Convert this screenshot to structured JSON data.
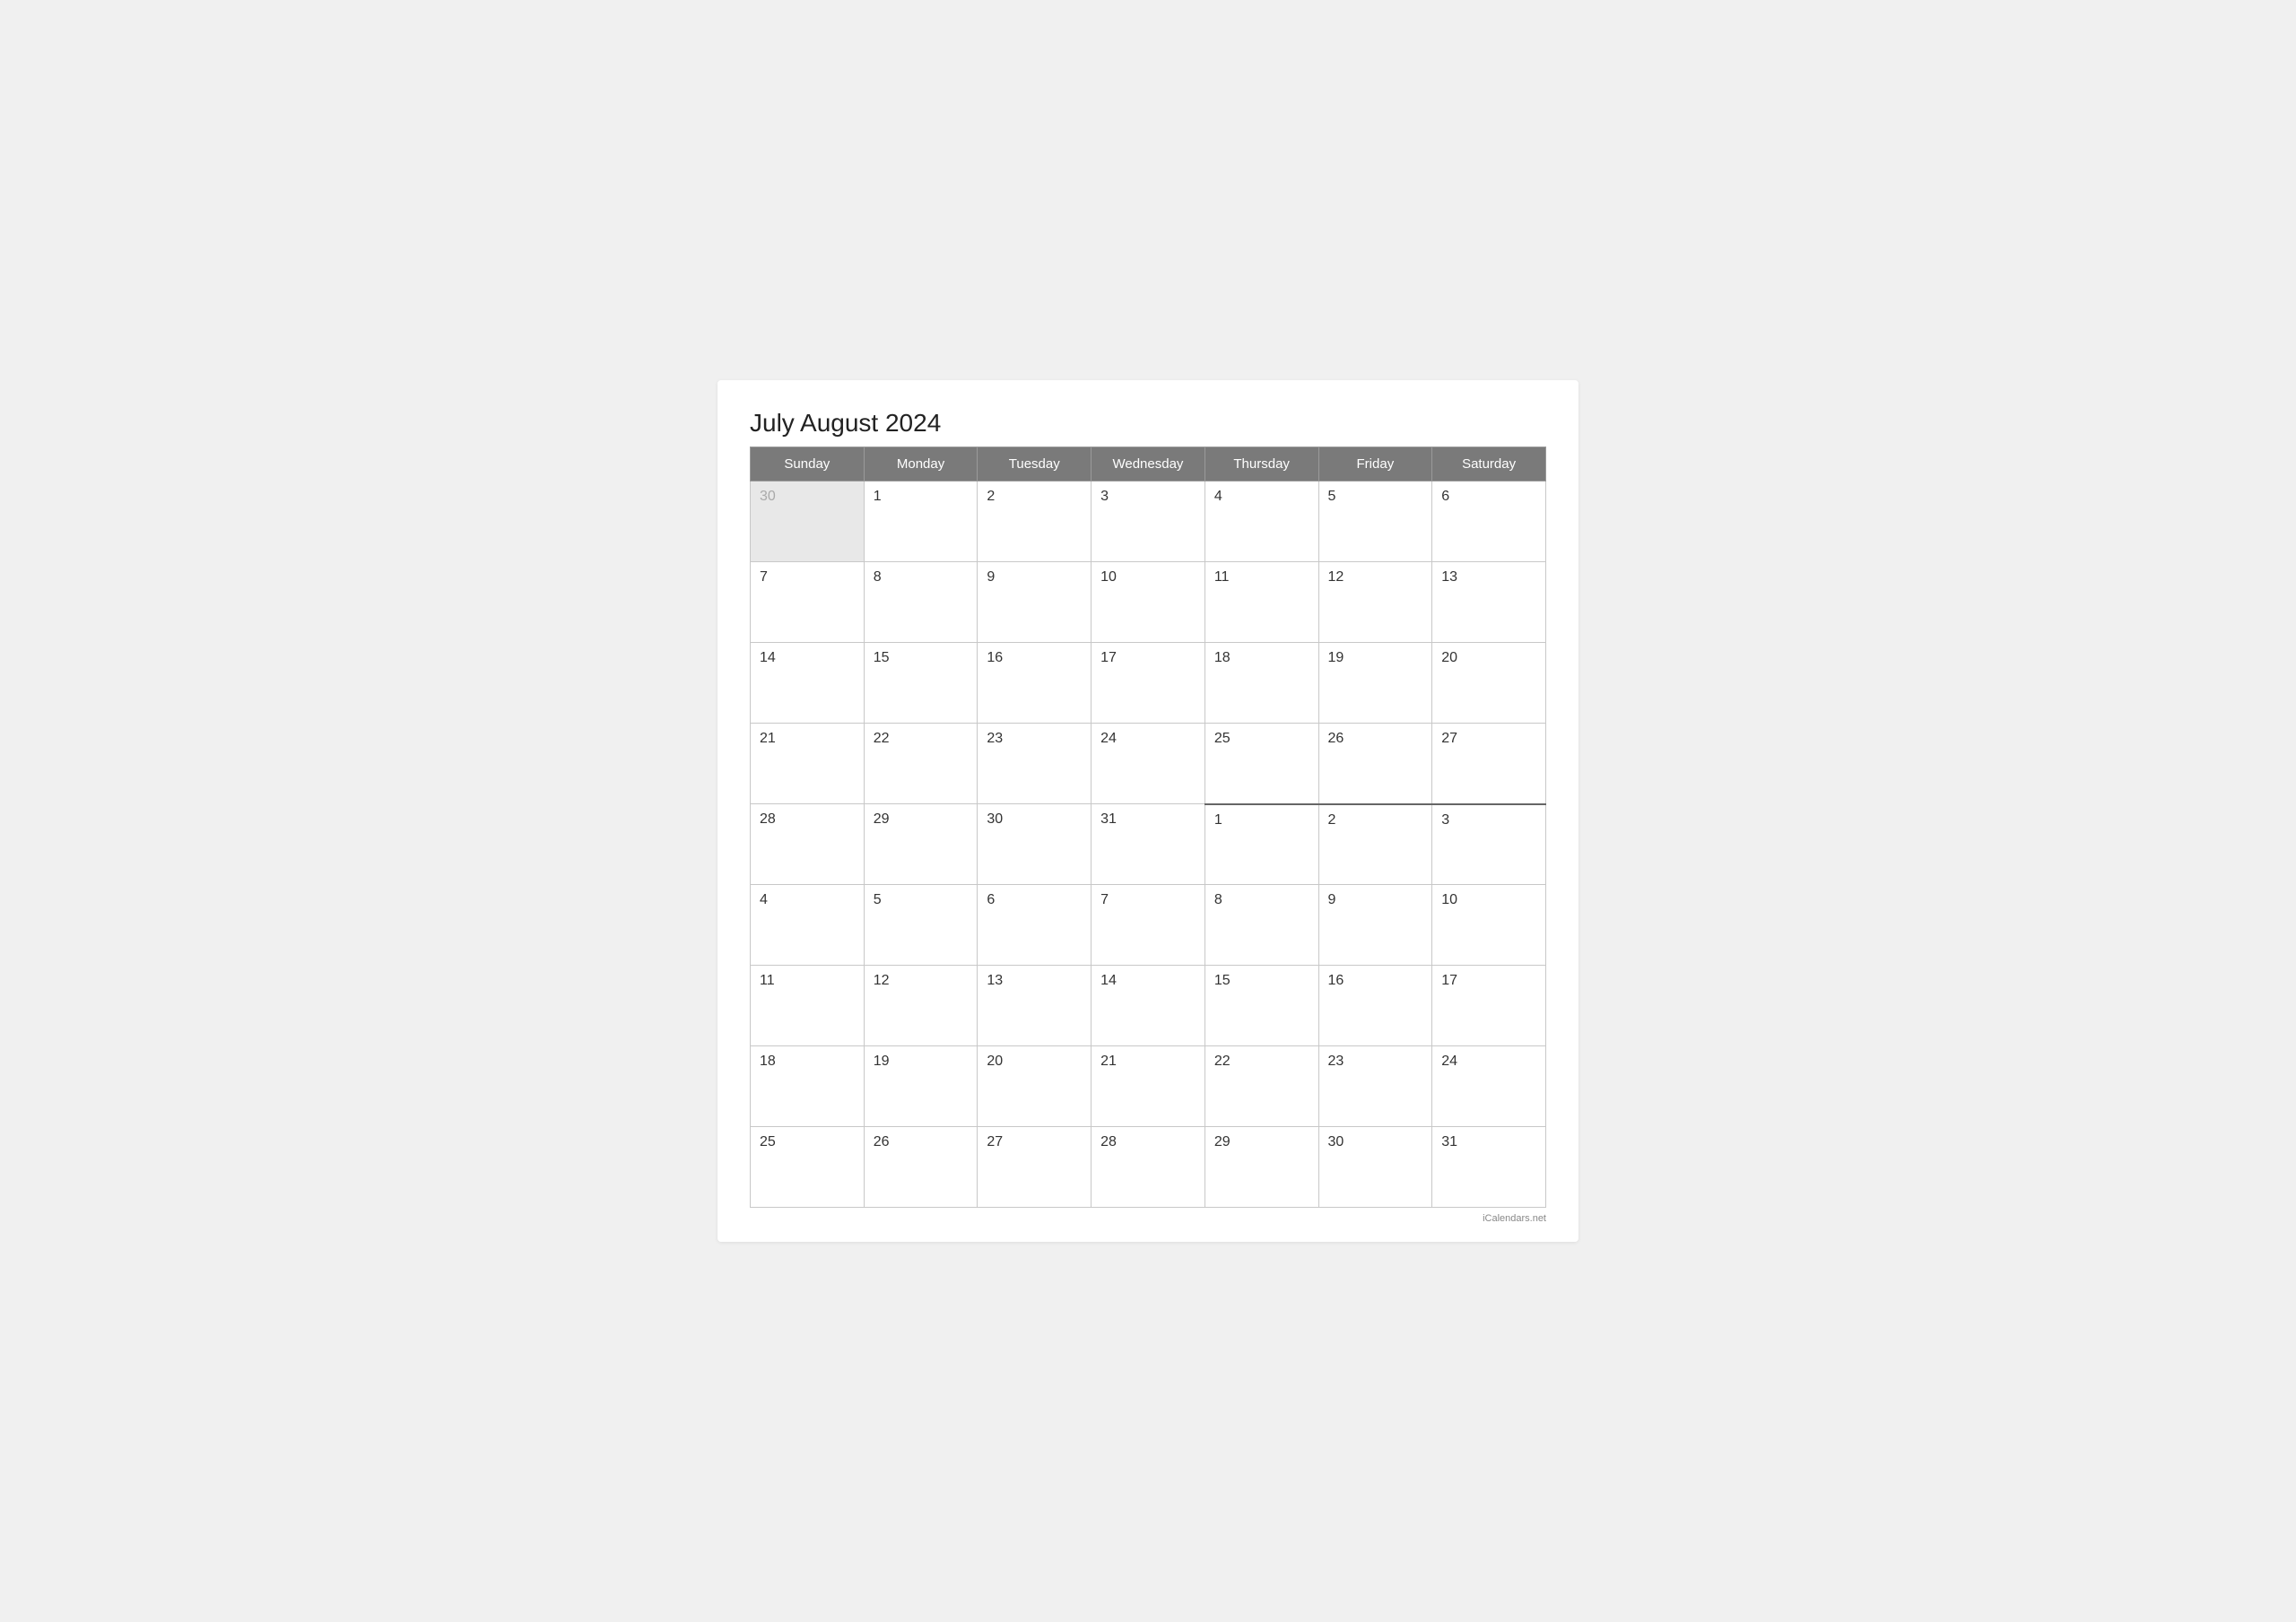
{
  "title": "July August 2024",
  "header": {
    "days": [
      "Sunday",
      "Monday",
      "Tuesday",
      "Wednesday",
      "Thursday",
      "Friday",
      "Saturday"
    ]
  },
  "weeks": [
    {
      "cells": [
        {
          "day": "30",
          "type": "other-month"
        },
        {
          "day": "1",
          "type": "jul"
        },
        {
          "day": "2",
          "type": "jul"
        },
        {
          "day": "3",
          "type": "jul"
        },
        {
          "day": "4",
          "type": "jul"
        },
        {
          "day": "5",
          "type": "jul"
        },
        {
          "day": "6",
          "type": "jul"
        }
      ]
    },
    {
      "cells": [
        {
          "day": "7",
          "type": "jul"
        },
        {
          "day": "8",
          "type": "jul"
        },
        {
          "day": "9",
          "type": "jul"
        },
        {
          "day": "10",
          "type": "jul"
        },
        {
          "day": "11",
          "type": "jul"
        },
        {
          "day": "12",
          "type": "jul"
        },
        {
          "day": "13",
          "type": "jul"
        }
      ]
    },
    {
      "cells": [
        {
          "day": "14",
          "type": "jul"
        },
        {
          "day": "15",
          "type": "jul"
        },
        {
          "day": "16",
          "type": "jul"
        },
        {
          "day": "17",
          "type": "jul"
        },
        {
          "day": "18",
          "type": "jul"
        },
        {
          "day": "19",
          "type": "jul"
        },
        {
          "day": "20",
          "type": "jul"
        }
      ]
    },
    {
      "cells": [
        {
          "day": "21",
          "type": "jul"
        },
        {
          "day": "22",
          "type": "jul"
        },
        {
          "day": "23",
          "type": "jul"
        },
        {
          "day": "24",
          "type": "jul"
        },
        {
          "day": "25",
          "type": "jul"
        },
        {
          "day": "26",
          "type": "jul"
        },
        {
          "day": "27",
          "type": "jul"
        }
      ]
    },
    {
      "cells": [
        {
          "day": "28",
          "type": "jul"
        },
        {
          "day": "29",
          "type": "jul"
        },
        {
          "day": "30",
          "type": "jul"
        },
        {
          "day": "31",
          "type": "jul"
        },
        {
          "day": "1",
          "type": "aug"
        },
        {
          "day": "2",
          "type": "aug"
        },
        {
          "day": "3",
          "type": "aug"
        }
      ]
    },
    {
      "cells": [
        {
          "day": "4",
          "type": "aug"
        },
        {
          "day": "5",
          "type": "aug"
        },
        {
          "day": "6",
          "type": "aug"
        },
        {
          "day": "7",
          "type": "aug"
        },
        {
          "day": "8",
          "type": "aug"
        },
        {
          "day": "9",
          "type": "aug"
        },
        {
          "day": "10",
          "type": "aug"
        }
      ]
    },
    {
      "cells": [
        {
          "day": "11",
          "type": "aug"
        },
        {
          "day": "12",
          "type": "aug"
        },
        {
          "day": "13",
          "type": "aug"
        },
        {
          "day": "14",
          "type": "aug"
        },
        {
          "day": "15",
          "type": "aug"
        },
        {
          "day": "16",
          "type": "aug"
        },
        {
          "day": "17",
          "type": "aug"
        }
      ]
    },
    {
      "cells": [
        {
          "day": "18",
          "type": "aug"
        },
        {
          "day": "19",
          "type": "aug"
        },
        {
          "day": "20",
          "type": "aug"
        },
        {
          "day": "21",
          "type": "aug"
        },
        {
          "day": "22",
          "type": "aug"
        },
        {
          "day": "23",
          "type": "aug"
        },
        {
          "day": "24",
          "type": "aug"
        }
      ]
    },
    {
      "cells": [
        {
          "day": "25",
          "type": "aug"
        },
        {
          "day": "26",
          "type": "aug"
        },
        {
          "day": "27",
          "type": "aug"
        },
        {
          "day": "28",
          "type": "aug"
        },
        {
          "day": "29",
          "type": "aug"
        },
        {
          "day": "30",
          "type": "aug"
        },
        {
          "day": "31",
          "type": "aug"
        }
      ]
    }
  ],
  "watermark": "iCalendars.net"
}
